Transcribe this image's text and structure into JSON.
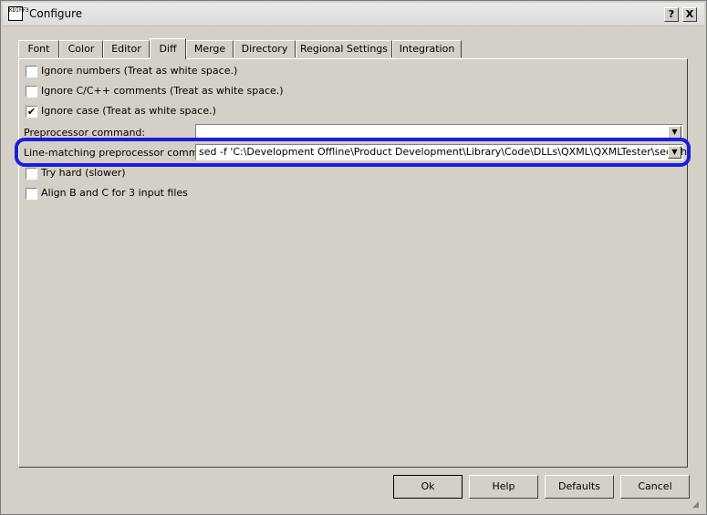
{
  "window": {
    "title": "Configure",
    "icon_text": "KDIFF3",
    "help_label": "?",
    "close_label": "X"
  },
  "tabs": [
    {
      "label": "Font"
    },
    {
      "label": "Color"
    },
    {
      "label": "Editor"
    },
    {
      "label": "Diff",
      "active": true
    },
    {
      "label": "Merge"
    },
    {
      "label": "Directory"
    },
    {
      "label": "Regional Settings"
    },
    {
      "label": "Integration"
    }
  ],
  "diff": {
    "ignore_numbers": {
      "label": "Ignore numbers (Treat as white space.)",
      "checked": false
    },
    "ignore_comments": {
      "label": "Ignore C/C++ comments (Treat as white space.)",
      "checked": false
    },
    "ignore_case": {
      "label": "Ignore case (Treat as white space.)",
      "checked": true
    },
    "preprocessor": {
      "label": "Preprocessor command:",
      "value": ""
    },
    "line_matching": {
      "label": "Line-matching preprocessor command:",
      "value": "sed -f 'C:\\Development Offline\\Product Development\\Library\\Code\\DLLs\\QXML\\QXMLTester\\sed.sh'"
    },
    "try_hard": {
      "label": "Try hard (slower)",
      "checked": false
    },
    "align_bc": {
      "label": "Align B and C for 3 input files",
      "checked": false
    }
  },
  "buttons": {
    "ok": "Ok",
    "help": "Help",
    "defaults": "Defaults",
    "cancel": "Cancel"
  },
  "icons": {
    "check": "✔",
    "dropdown": "▼",
    "grip": "◢"
  },
  "colors": {
    "highlight": "#1d1dd6",
    "dialog_bg": "#d4d0c8"
  }
}
